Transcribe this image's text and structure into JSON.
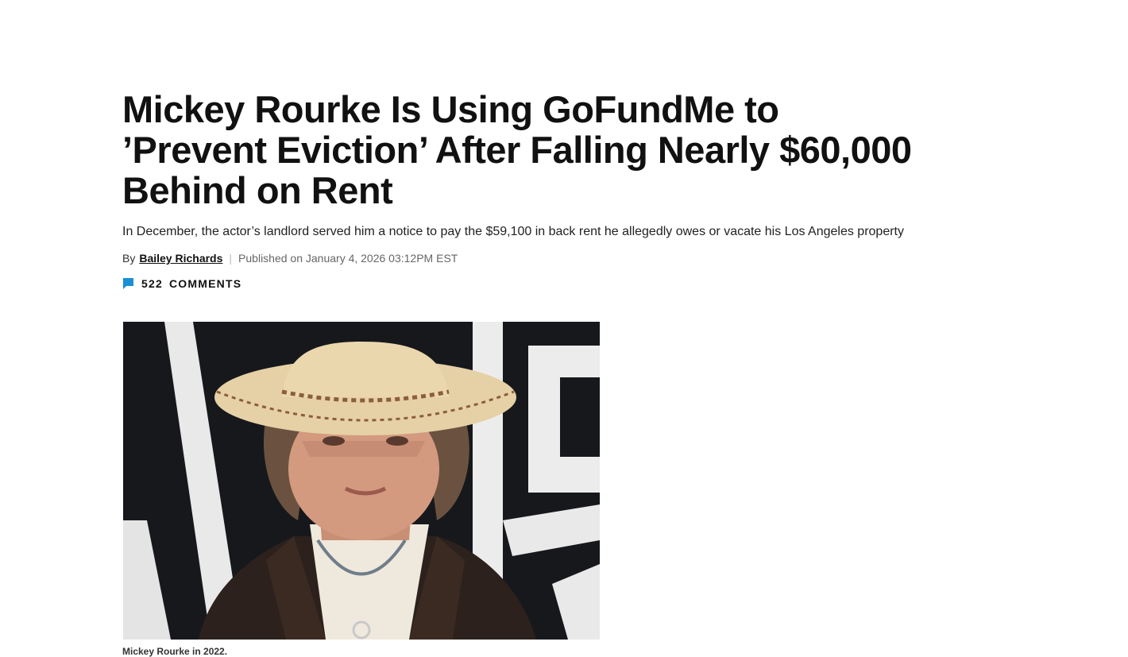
{
  "article": {
    "headline": "Mickey Rourke Is Using GoFundMe to ’Prevent Eviction’ After Falling Nearly $60,000 Behind on Rent",
    "dek": "In December, the actor’s landlord served him a notice to pay the $59,100 in back rent he allegedly owes or vacate his Los Angeles property",
    "byline": {
      "prefix": "By",
      "author": "Bailey Richards",
      "separator": "|",
      "published": "Published on January 4, 2026 03:12PM EST"
    },
    "comments": {
      "icon": "comment-bubble-icon",
      "count": "522",
      "label": "COMMENTS",
      "icon_color": "#1a8fd6"
    },
    "image": {
      "caption": "Mickey Rourke in 2022."
    }
  }
}
